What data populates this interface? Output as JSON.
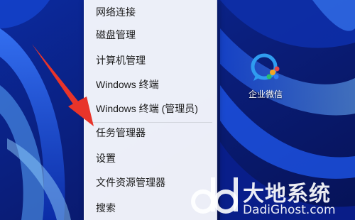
{
  "context_menu": {
    "items": [
      {
        "label": "网络连接"
      },
      {
        "label": "磁盘管理"
      },
      {
        "label": "计算机管理"
      },
      {
        "label": "Windows 终端"
      },
      {
        "label": "Windows 终端 (管理员)"
      },
      {
        "label": "任务管理器"
      },
      {
        "label": "设置"
      },
      {
        "label": "文件资源管理器"
      },
      {
        "label": "搜索"
      }
    ]
  },
  "desktop": {
    "icon_label": "企业微信",
    "icon_name": "wecom-icon"
  },
  "watermark": {
    "title": "大地系统",
    "url": "DadiGhost.com"
  },
  "annotation": {
    "arrow_color": "#e8342a",
    "points_to": "任务管理器"
  }
}
